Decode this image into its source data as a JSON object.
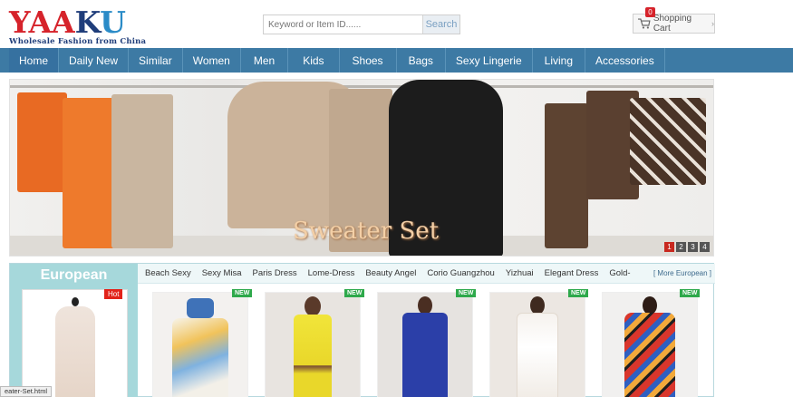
{
  "header": {
    "logo_text_1": "YAA",
    "logo_text_2": "K",
    "logo_text_3": "U",
    "logo_tagline": "Wholesale Fashion from China",
    "search": {
      "placeholder": "Keyword or Item ID......",
      "button_label": "Search"
    },
    "cart": {
      "label": "Shopping Cart",
      "count": "0",
      "icon": "cart-icon"
    }
  },
  "nav": {
    "items": [
      "Home",
      "Daily New",
      "Similar",
      "Women",
      "Men",
      "Kids",
      "Shoes",
      "Bags",
      "Sexy Lingerie",
      "Living",
      "Accessories"
    ]
  },
  "banner": {
    "title": "Sweater Set",
    "pages": [
      "1",
      "2",
      "3",
      "4"
    ],
    "active_page": "1"
  },
  "section": {
    "title": "European",
    "hot_badge": "Hot",
    "subcategories": [
      "Beach Sexy",
      "Sexy Misa",
      "Paris Dress",
      "Lome-Dress",
      "Beauty Angel",
      "Corio Guangzhou",
      "Yizhuai",
      "Elegant Dress",
      "Gold-"
    ],
    "more_link": "[ More European ]",
    "new_badge": "NEW",
    "products": [
      {
        "name": "floral-maxi-skirt"
      },
      {
        "name": "yellow-slit-dress"
      },
      {
        "name": "blue-jumpsuit"
      },
      {
        "name": "white-floral-gown"
      },
      {
        "name": "printed-kaftan-dress"
      }
    ]
  },
  "status_bar": {
    "url_text": "eater-Set.html"
  },
  "colors": {
    "nav": "#3d7aa4",
    "logo_red": "#d6232b",
    "section_panel": "#a6d8db",
    "new_badge": "#2ea94b",
    "hot_badge": "#e2231a"
  }
}
